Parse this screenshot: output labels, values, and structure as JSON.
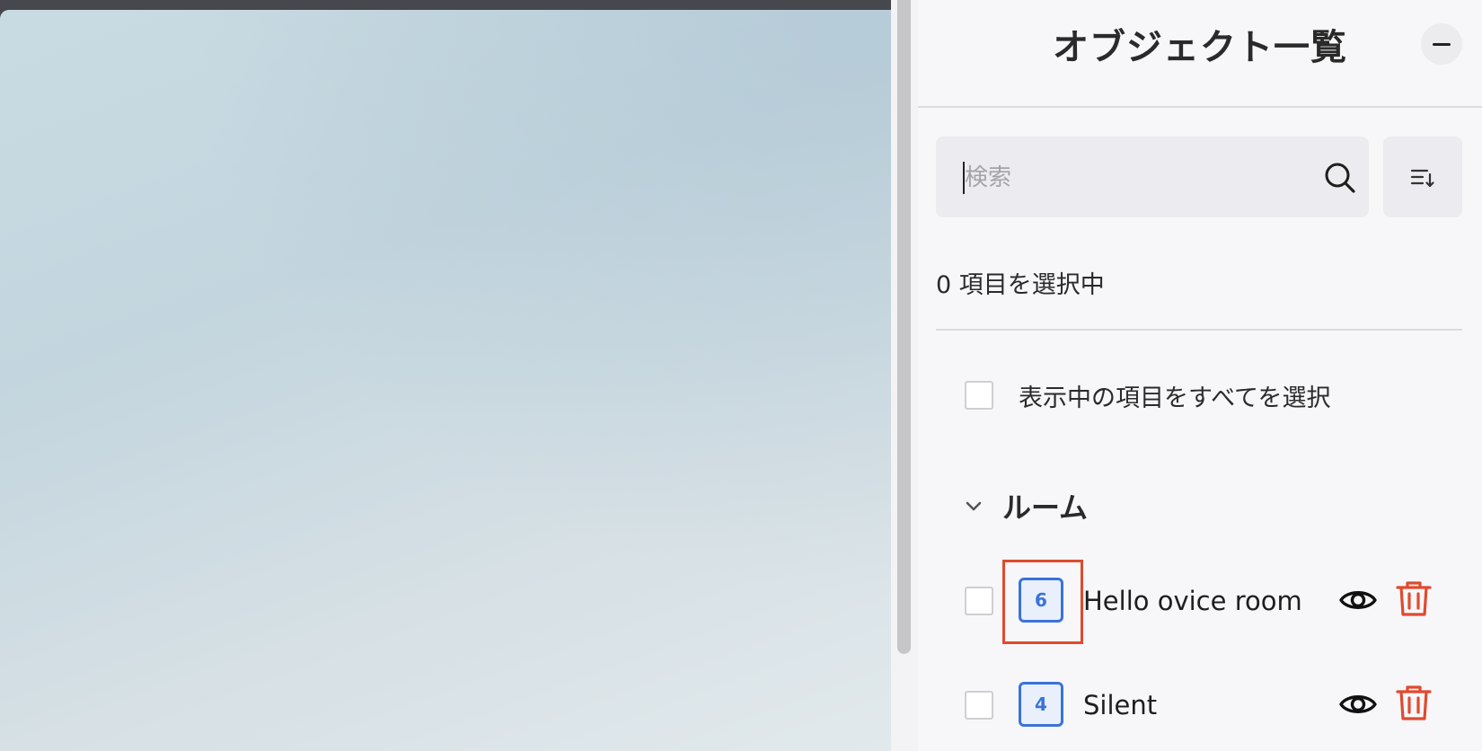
{
  "panel": {
    "title": "オブジェクト一覧",
    "collapse_icon": "minus-icon"
  },
  "search": {
    "placeholder": "検索",
    "value": "",
    "icon": "search-icon"
  },
  "sort": {
    "icon": "sort-icon"
  },
  "selection": {
    "count_text": "0 項目を選択中",
    "select_all_label": "表示中の項目をすべてを選択",
    "select_all_checked": false
  },
  "group": {
    "title": "ルーム",
    "expanded": true,
    "chevron_icon": "chevron-down-icon",
    "items": [
      {
        "name": "Hello ovice room",
        "count": "6",
        "checked": false,
        "highlighted": true,
        "visibility_icon": "eye-icon",
        "delete_icon": "trash-icon"
      },
      {
        "name": "Silent",
        "count": "4",
        "checked": false,
        "highlighted": false,
        "visibility_icon": "eye-icon",
        "delete_icon": "trash-icon"
      }
    ]
  },
  "colors": {
    "accent_blue": "#3a73d9",
    "delete_red": "#e04a2f",
    "highlight_red": "#e04a2f",
    "panel_bg": "#f7f7f9"
  }
}
